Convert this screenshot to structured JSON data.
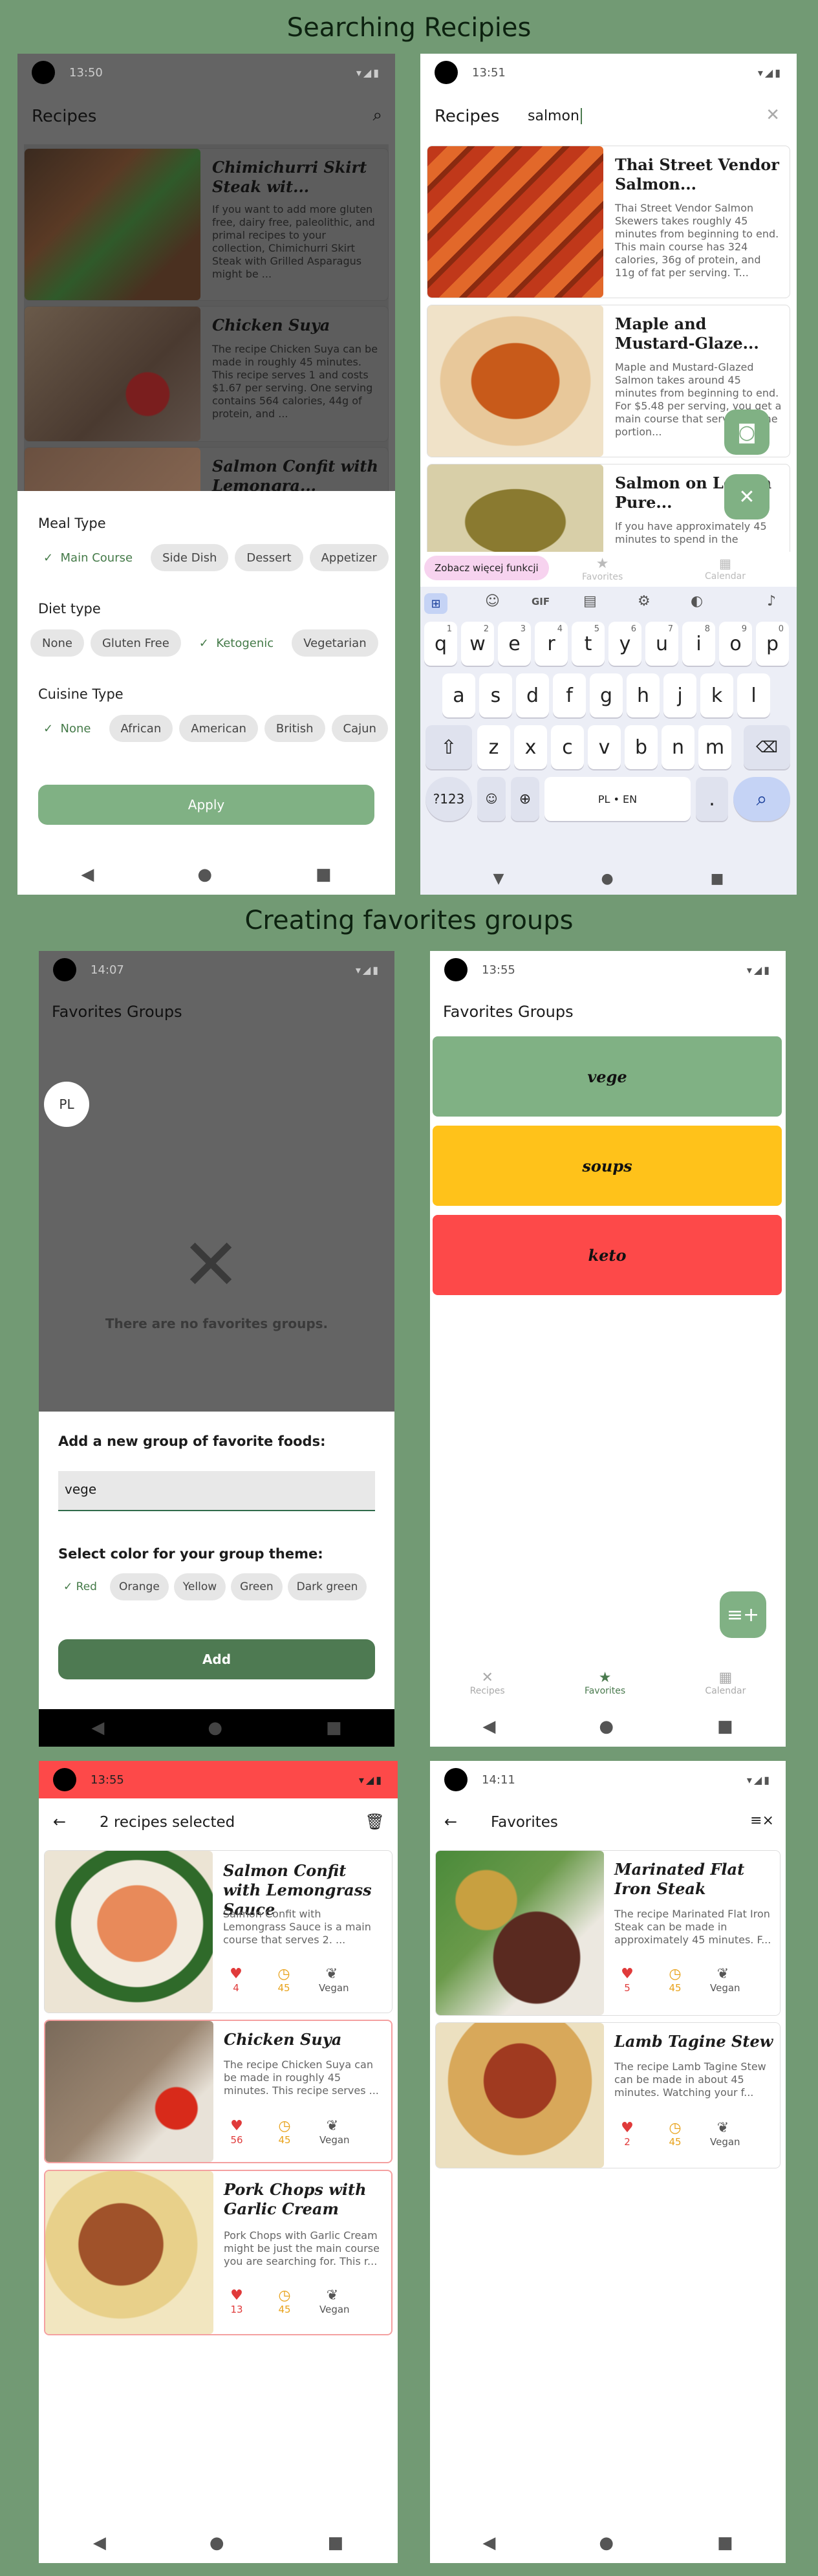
{
  "headings": {
    "search": "Searching Recipies",
    "favorites": "Creating favorites groups"
  },
  "screen1": {
    "time": "13:50",
    "title": "Recipes",
    "search_icon": "search-icon",
    "recipes": [
      {
        "title": "Chimichurri Skirt Steak wit...",
        "desc": "If you want to add more gluten free, dairy free, paleolithic, and primal recipes to your collection, Chimichurri Skirt Steak with Grilled Asparagus might be ..."
      },
      {
        "title": "Chicken Suya",
        "desc": "The recipe Chicken Suya can be made in roughly 45 minutes. This recipe serves 1 and costs $1.67 per serving. One serving contains 564 calories, 44g of protein, and ..."
      },
      {
        "title": "Salmon Confit with Lemongra...",
        "desc": ""
      }
    ],
    "filters": {
      "meal_label": "Meal Type",
      "meal": [
        "Main Course",
        "Side Dish",
        "Dessert",
        "Appetizer"
      ],
      "diet_label": "Diet type",
      "diet": [
        "None",
        "Gluten Free",
        "Ketogenic",
        "Vegetarian"
      ],
      "cuisine_label": "Cuisine Type",
      "cuisine": [
        "None",
        "African",
        "American",
        "British",
        "Cajun"
      ],
      "apply": "Apply"
    }
  },
  "screen2": {
    "time": "13:51",
    "title": "Recipes",
    "query": "salmon",
    "recipes": [
      {
        "title": "Thai Street Vendor Salmon...",
        "desc": "Thai Street Vendor Salmon Skewers takes roughly 45 minutes from beginning to end. This main course has 324 calories, 36g of protein, and 11g of fat per serving. T..."
      },
      {
        "title": "Maple and Mustard-Glaze...",
        "desc": "Maple and Mustard-Glazed Salmon takes around 45 minutes from beginning to end. For $5.48 per serving, you get a main course that serves 2. One portion..."
      },
      {
        "title": "Salmon on Lemon Pure...",
        "desc": "If you have approximately 45 minutes to spend in the"
      }
    ],
    "tooltip": "Zobacz więcej funkcji",
    "nav": [
      "Favorites",
      "Calendar"
    ],
    "kb": {
      "gif": "GIF",
      "row1": [
        "q",
        "w",
        "e",
        "r",
        "t",
        "y",
        "u",
        "i",
        "o",
        "p"
      ],
      "sup1": [
        "1",
        "2",
        "3",
        "4",
        "5",
        "6",
        "7",
        "8",
        "9",
        "0"
      ],
      "row2": [
        "a",
        "s",
        "d",
        "f",
        "g",
        "h",
        "j",
        "k",
        "l"
      ],
      "row3": [
        "z",
        "x",
        "c",
        "v",
        "b",
        "n",
        "m"
      ],
      "num": "?123",
      "space": "PL • EN",
      "dot": "."
    }
  },
  "screen3": {
    "time": "14:07",
    "title": "Favorites Groups",
    "avatar": "PL",
    "empty": "There are no favorites groups.",
    "sheet_title": "Add a new group of favorite foods:",
    "input": "vege",
    "color_label": "Select color for your group theme:",
    "colors": [
      "Red",
      "Orange",
      "Yellow",
      "Green",
      "Dark green"
    ],
    "add": "Add"
  },
  "screen4": {
    "time": "13:55",
    "title": "Favorites Groups",
    "groups": [
      {
        "name": "vege",
        "color": "#80b184"
      },
      {
        "name": "soups",
        "color": "#ffc21a"
      },
      {
        "name": "keto",
        "color": "#fd4949"
      }
    ],
    "nav": [
      "Recipes",
      "Favorites",
      "Calendar"
    ]
  },
  "screen5": {
    "time": "13:55",
    "title": "2 recipes selected",
    "recipes": [
      {
        "title": "Salmon Confit with Lemongrass Sauce",
        "desc": "Salmon Confit with Lemongrass Sauce is a main course that serves 2. ...",
        "likes": "4",
        "time": "45",
        "diet": "Vegan"
      },
      {
        "title": "Chicken Suya",
        "desc": "The recipe Chicken Suya can be made in roughly 45 minutes. This recipe serves ...",
        "likes": "56",
        "time": "45",
        "diet": "Vegan"
      },
      {
        "title": "Pork Chops with Garlic Cream",
        "desc": "Pork Chops with Garlic Cream might be just the main course you are searching for. This r...",
        "likes": "13",
        "time": "45",
        "diet": "Vegan"
      }
    ]
  },
  "screen6": {
    "time": "14:11",
    "title": "Favorites",
    "recipes": [
      {
        "title": "Marinated Flat Iron Steak",
        "desc": "The recipe Marinated Flat Iron Steak can be made in approximately 45 minutes. F...",
        "likes": "5",
        "time": "45",
        "diet": "Vegan"
      },
      {
        "title": "Lamb Tagine Stew",
        "desc": "The recipe Lamb Tagine Stew can be made in about 45 minutes. Watching your f...",
        "likes": "2",
        "time": "45",
        "diet": "Vegan"
      }
    ]
  }
}
